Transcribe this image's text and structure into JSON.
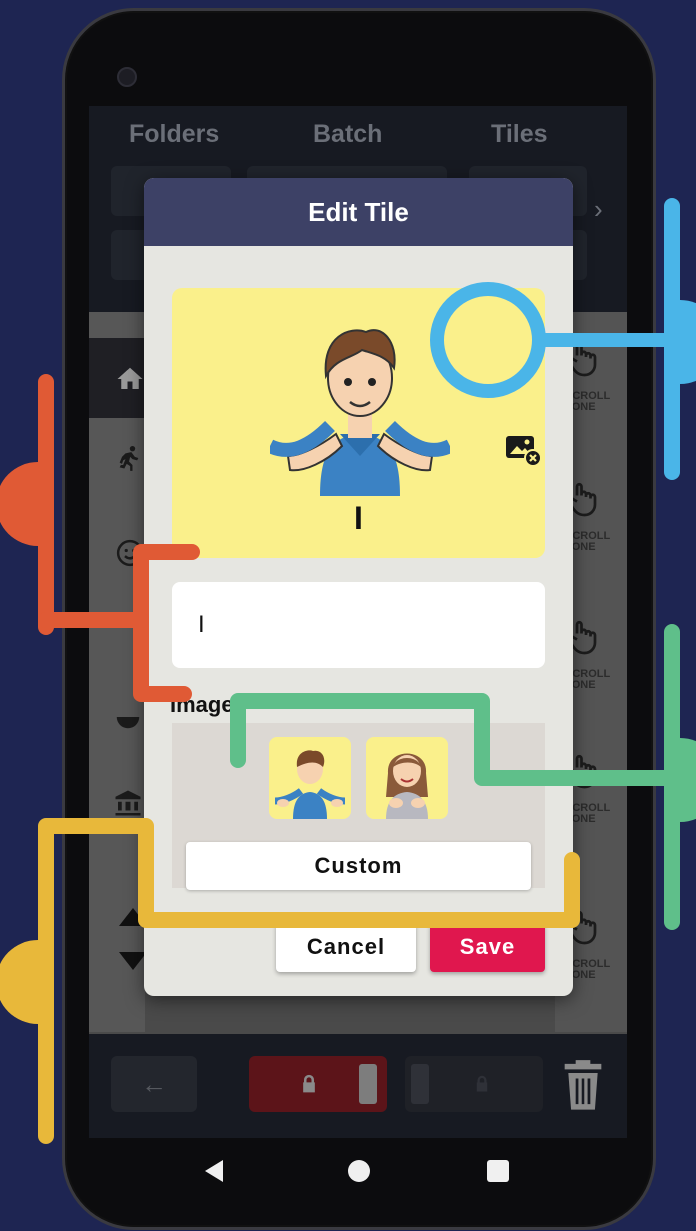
{
  "tabs": {
    "folders": "Folders",
    "batch": "Batch",
    "tiles": "Tiles"
  },
  "modal": {
    "title": "Edit Tile",
    "preview_label": "I",
    "name_value": "I",
    "images_label": "Images",
    "custom_label": "Custom",
    "cancel_label": "Cancel",
    "save_label": "Save"
  },
  "scroll_zone": {
    "line1": "SCROLL",
    "line2": "ZONE"
  },
  "icons": {
    "clear_image": "image-remove-icon",
    "home": "home-icon",
    "back": "arrow-left-icon",
    "lock": "lock-icon",
    "trash": "trash-icon",
    "chevron": "chevron-right-icon"
  },
  "colors": {
    "background": "#1e2552",
    "modal_header": "#3d4166",
    "tile_yellow": "#faf08b",
    "save": "#e0174e",
    "callout_blue": "#4ab5e8",
    "callout_red": "#e05a35",
    "callout_green": "#5fbf8a",
    "callout_yellow": "#e8b83a"
  }
}
